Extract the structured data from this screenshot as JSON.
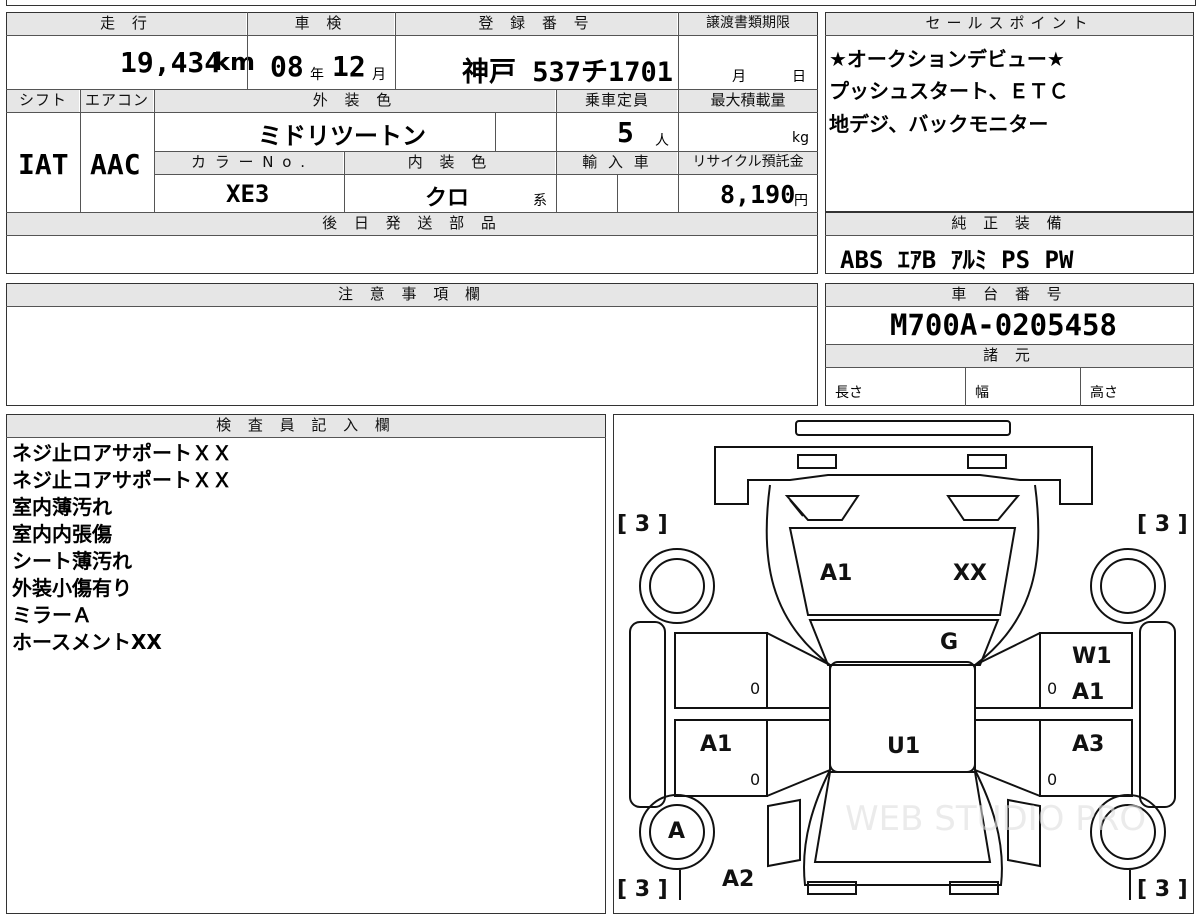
{
  "header": {
    "mileage_label": "走 行",
    "inspection_label": "車 検",
    "registration_label": "登 録 番 号",
    "transfer_deadline_label": "譲渡書類期限",
    "sales_points_label": "セールスポイント",
    "shift_label": "シフト",
    "aircon_label": "エアコン",
    "exterior_color_label": "外 装 色",
    "capacity_label": "乗車定員",
    "max_load_label": "最大積載量",
    "color_no_label": "カ ラ ー N o .",
    "interior_color_label": "内 装 色",
    "import_label": "輸 入 車",
    "recycle_label": "リサイクル預託金",
    "later_parts_label": "後 日 発 送 部 品",
    "standard_equipment_label": "純 正 装 備",
    "notes_label": "注 意 事 項 欄",
    "chassis_label": "車 台 番 号",
    "specs_label": "諸 元",
    "inspector_label": "検 査 員 記 入 欄"
  },
  "vehicle": {
    "mileage": "19,434",
    "mileage_unit": "km",
    "inspection_year": "08",
    "year_unit": "年",
    "inspection_month": "12",
    "month_unit": "月",
    "plate": "神戸 537チ1701",
    "deadline_month_unit": "月",
    "deadline_day_unit": "日",
    "shift": "IAT",
    "aircon": "AAC",
    "exterior_color": "ミドリツートン",
    "capacity": "5",
    "capacity_unit": "人",
    "load_unit": "kg",
    "color_no": "XE3",
    "interior_color": "クロ",
    "interior_suffix": "系",
    "recycle_fee": "8,190",
    "recycle_unit": "円",
    "chassis_no": "M700A-0205458",
    "length_label": "長さ",
    "width_label": "幅",
    "height_label": "高さ"
  },
  "sales_points": [
    "★オークションデビュー★",
    "プッシュスタート、ＥＴＣ",
    "地デジ、バックモニター"
  ],
  "standard_equipment": "ABS ｴｱB ｱﾙﾐ PS PW",
  "inspector_notes": [
    "ネジ止ロアサポートＸＸ",
    "ネジ止コアサポートＸＸ",
    "室内薄汚れ",
    "室内内張傷",
    "シート薄汚れ",
    "外装小傷有り",
    "ミラーＡ",
    "ホースメントXX"
  ],
  "diagram": {
    "tire_fl": "[ 3 ]",
    "tire_fr": "[ 3 ]",
    "tire_rl": "[ 3 ]",
    "tire_rr": "[ 3 ]",
    "hood_left": "A1",
    "hood_right": "XX",
    "windshield": "G",
    "right_front_door_1": "W1",
    "right_front_door_2": "A1",
    "left_rear_door": "A1",
    "roof": "U1",
    "right_rear_door": "A3",
    "left_wheel_rear": "A",
    "left_quarter": "A2",
    "door_mark_lf": "0",
    "door_mark_lr": "0",
    "door_mark_rf": "0",
    "door_mark_rr": "0",
    "watermark": "WEB STUDIO PRO"
  }
}
